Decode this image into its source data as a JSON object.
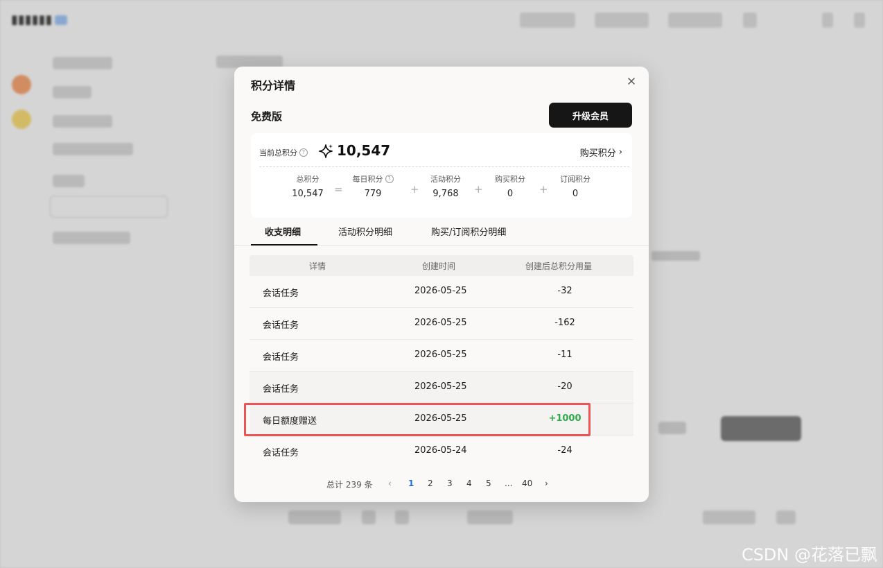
{
  "modal": {
    "title": "积分详情",
    "plan_name": "免费版",
    "upgrade_label": "升级会员",
    "current_total_label": "当前总积分",
    "current_total_value": "10,547",
    "buy_link_label": "购买积分",
    "breakdown": [
      {
        "label": "总积分",
        "value": "10,547",
        "has_help": false
      },
      {
        "label": "每日积分",
        "value": "779",
        "has_help": true
      },
      {
        "label": "活动积分",
        "value": "9,768",
        "has_help": false
      },
      {
        "label": "购买积分",
        "value": "0",
        "has_help": false
      },
      {
        "label": "订阅积分",
        "value": "0",
        "has_help": false
      }
    ],
    "operators": [
      "=",
      "+",
      "+",
      "+"
    ],
    "tabs": [
      {
        "label": "收支明细",
        "active": true
      },
      {
        "label": "活动积分明细",
        "active": false
      },
      {
        "label": "购买/订阅积分明细",
        "active": false
      }
    ],
    "table": {
      "headers": [
        "详情",
        "创建时间",
        "创建后总积分用量"
      ],
      "rows": [
        {
          "detail": "会话任务",
          "date": "2026-05-25",
          "amount": "-32"
        },
        {
          "detail": "会话任务",
          "date": "2026-05-25",
          "amount": "-162"
        },
        {
          "detail": "会话任务",
          "date": "2026-05-25",
          "amount": "-11"
        },
        {
          "detail": "会话任务",
          "date": "2026-05-25",
          "amount": "-20"
        },
        {
          "detail": "每日额度赠送",
          "date": "2026-05-25",
          "amount": "+1000"
        },
        {
          "detail": "会话任务",
          "date": "2026-05-24",
          "amount": "-24"
        }
      ]
    },
    "pagination": {
      "total_label": "总计 239 条",
      "pages": [
        "1",
        "2",
        "3",
        "4",
        "5",
        "...",
        "40"
      ],
      "current": "1"
    }
  },
  "colors": {
    "positive": "#2eaa4a",
    "highlight": "#ea5455",
    "active_page": "#1f6fd6",
    "primary_button": "#161616"
  },
  "watermark": "CSDN @花落已飘"
}
